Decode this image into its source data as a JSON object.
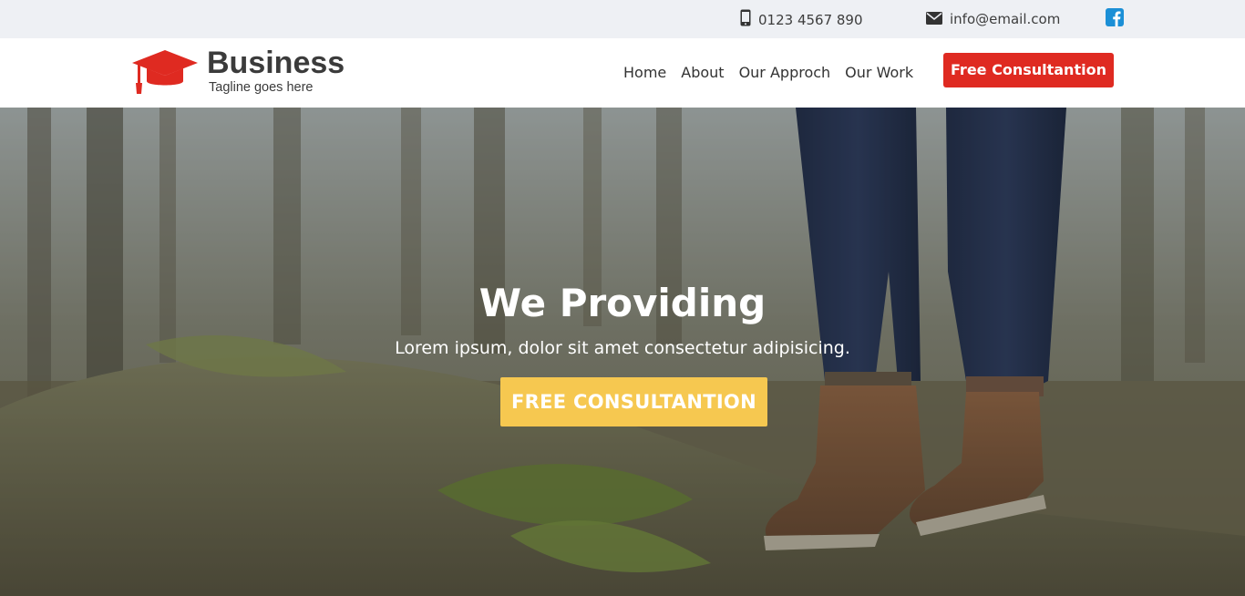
{
  "topbar": {
    "phone": "0123 4567 890",
    "email": "info@email.com"
  },
  "header": {
    "brand": "Business",
    "tagline": "Tagline goes here",
    "nav": [
      "Home",
      "About",
      "Our Approch",
      "Our Work"
    ],
    "cta": "Free Consultantion"
  },
  "hero": {
    "title": "We Providing",
    "subtitle": "Lorem ipsum, dolor sit amet consectetur adipisicing.",
    "cta": "FREE CONSULTANTION"
  },
  "colors": {
    "accent_red": "#df2a21",
    "accent_yellow": "#f6c850",
    "facebook_blue": "#1b8fd6",
    "topbar_bg": "#eef0f4"
  },
  "icons": [
    "mobile-phone-icon",
    "envelope-icon",
    "facebook-icon",
    "graduation-cap-icon"
  ]
}
